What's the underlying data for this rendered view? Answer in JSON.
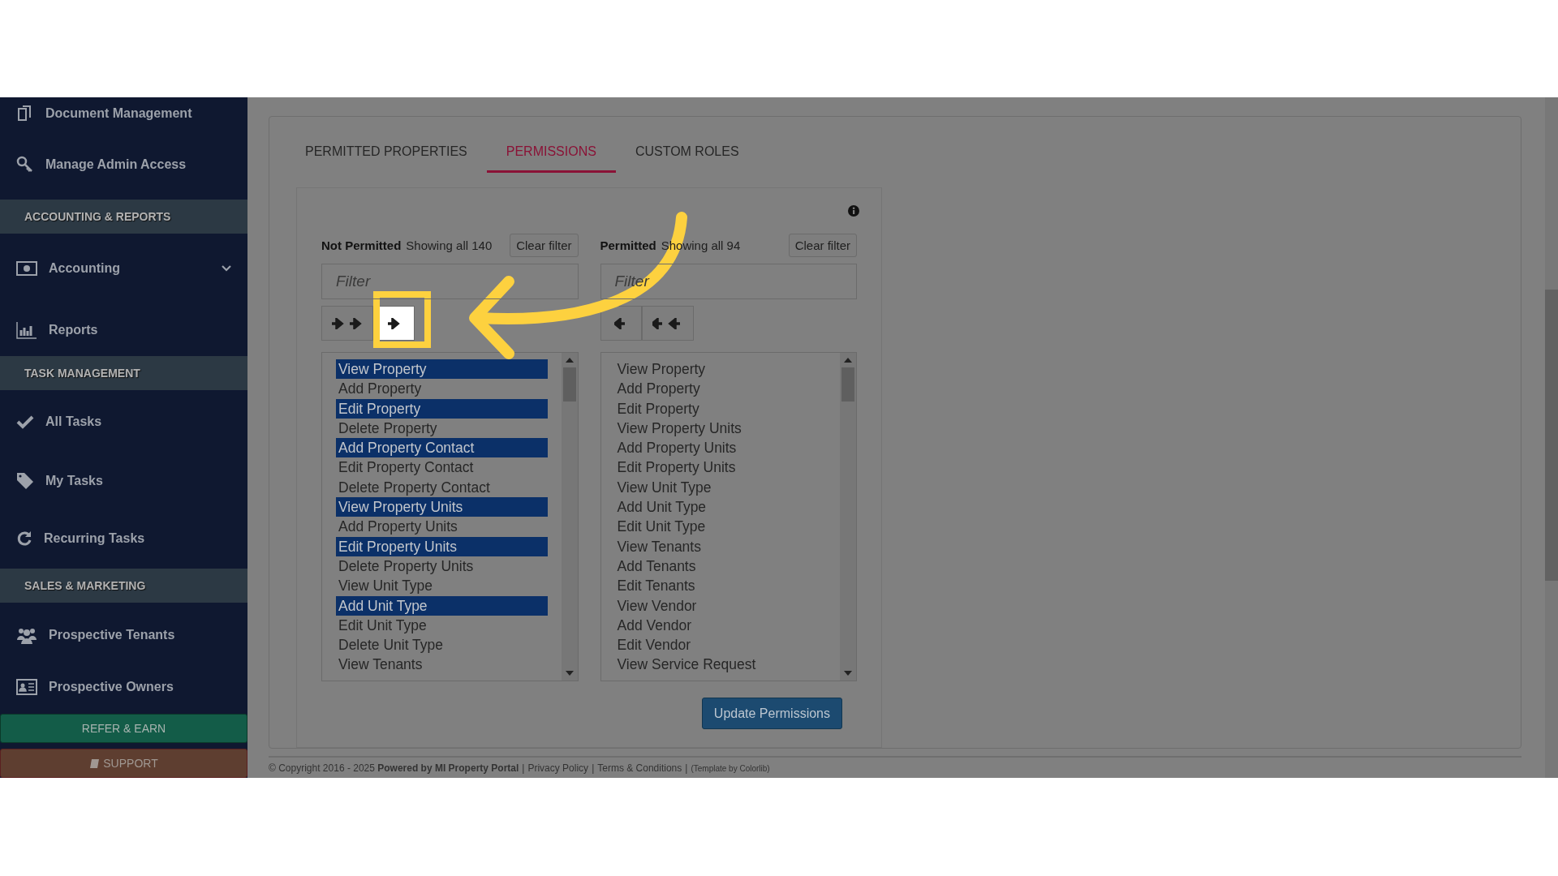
{
  "sidebar": {
    "items": [
      {
        "kind": "link",
        "label": "Document Management"
      },
      {
        "kind": "link",
        "label": "Manage Admin Access"
      },
      {
        "kind": "section",
        "label": "ACCOUNTING & REPORTS"
      },
      {
        "kind": "dropdown",
        "label": "Accounting"
      },
      {
        "kind": "link",
        "label": "Reports"
      },
      {
        "kind": "section",
        "label": "TASK MANAGEMENT"
      },
      {
        "kind": "link",
        "label": "All Tasks"
      },
      {
        "kind": "link",
        "label": "My Tasks"
      },
      {
        "kind": "link",
        "label": "Recurring Tasks"
      },
      {
        "kind": "section",
        "label": "SALES & MARKETING"
      },
      {
        "kind": "link",
        "label": "Prospective Tenants"
      },
      {
        "kind": "link",
        "label": "Prospective Owners"
      }
    ],
    "refer_button": "REFER & EARN",
    "support_button": "SUPPORT"
  },
  "tabs": [
    {
      "label": "PERMITTED PROPERTIES",
      "selected": false
    },
    {
      "label": "PERMISSIONS",
      "selected": true
    },
    {
      "label": "CUSTOM ROLES",
      "selected": false
    }
  ],
  "lists": [
    {
      "title": "Not Permitted",
      "count": "Showing all 140",
      "clear_button": "Clear filter",
      "filter": {
        "placeholder": "Filter"
      },
      "buttons": [
        {
          "kind": "right_all",
          "highlighted": false
        },
        {
          "kind": "right",
          "highlighted": true
        }
      ],
      "items": [
        {
          "label": "View Property",
          "selected": true
        },
        {
          "label": "Add Property",
          "selected": false
        },
        {
          "label": "Edit Property",
          "selected": true
        },
        {
          "label": "Delete Property",
          "selected": false
        },
        {
          "label": "Add Property Contact",
          "selected": true
        },
        {
          "label": "Edit Property Contact",
          "selected": false
        },
        {
          "label": "Delete Property Contact",
          "selected": false
        },
        {
          "label": "View Property Units",
          "selected": true
        },
        {
          "label": "Add Property Units",
          "selected": false
        },
        {
          "label": "Edit Property Units",
          "selected": true
        },
        {
          "label": "Delete Property Units",
          "selected": false
        },
        {
          "label": "View Unit Type",
          "selected": false
        },
        {
          "label": "Add Unit Type",
          "selected": true
        },
        {
          "label": "Edit Unit Type",
          "selected": false
        },
        {
          "label": "Delete Unit Type",
          "selected": false
        },
        {
          "label": "View Tenants",
          "selected": false
        }
      ]
    },
    {
      "title": "Permitted",
      "count": "Showing all 94",
      "clear_button": "Clear filter",
      "filter": {
        "placeholder": "Filter"
      },
      "buttons": [
        {
          "kind": "left",
          "highlighted": false
        },
        {
          "kind": "left_all",
          "highlighted": false
        }
      ],
      "items": [
        {
          "label": "View Property",
          "selected": false
        },
        {
          "label": "Add Property",
          "selected": false
        },
        {
          "label": "Edit Property",
          "selected": false
        },
        {
          "label": "View Property Units",
          "selected": false
        },
        {
          "label": "Add Property Units",
          "selected": false
        },
        {
          "label": "Edit Property Units",
          "selected": false
        },
        {
          "label": "View Unit Type",
          "selected": false
        },
        {
          "label": "Add Unit Type",
          "selected": false
        },
        {
          "label": "Edit Unit Type",
          "selected": false
        },
        {
          "label": "View Tenants",
          "selected": false
        },
        {
          "label": "Add Tenants",
          "selected": false
        },
        {
          "label": "Edit Tenants",
          "selected": false
        },
        {
          "label": "View Vendor",
          "selected": false
        },
        {
          "label": "Add Vendor",
          "selected": false
        },
        {
          "label": "Edit Vendor",
          "selected": false
        },
        {
          "label": "View Service Request",
          "selected": false
        }
      ]
    }
  ],
  "update_button": "Update Permissions",
  "footer": {
    "separator": "|",
    "copyright": "© Copyright 2016 - 2025 **Powered by MI Property Portal**",
    "links": [
      "Privacy Policy",
      "Terms & Conditions"
    ],
    "credit": "(Template by Colorlib)"
  }
}
